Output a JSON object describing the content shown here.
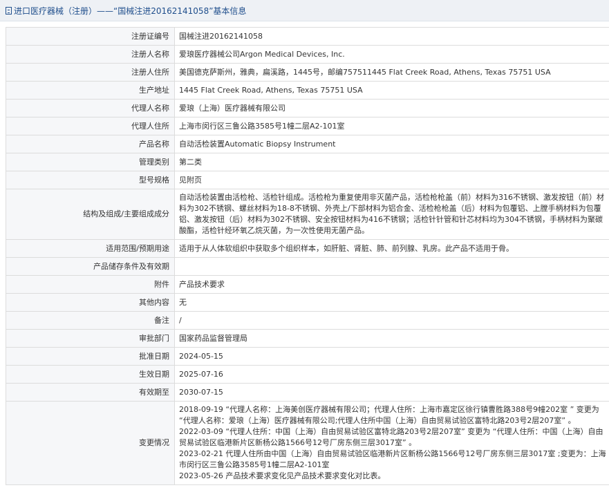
{
  "header": {
    "title": "进口医疗器械（注册）——“国械注进20162141058”基本信息"
  },
  "rows": [
    {
      "label": "注册证编号",
      "value": "国械注进20162141058"
    },
    {
      "label": "注册人名称",
      "value": "爱琅医疗器械公司Argon Medical Devices, Inc."
    },
    {
      "label": "注册人住所",
      "value": "美国德克萨斯州，雅典，扁溪路，1445号，邮编757511445 Flat Creek Road, Athens, Texas 75751 USA"
    },
    {
      "label": "生产地址",
      "value": "1445 Flat Creek Road, Athens, Texas 75751 USA"
    },
    {
      "label": "代理人名称",
      "value": "爱琅（上海）医疗器械有限公司"
    },
    {
      "label": "代理人住所",
      "value": "上海市闵行区三鲁公路3585号1幢二层A2-101室"
    },
    {
      "label": "产品名称",
      "value": "自动活检装置Automatic Biopsy Instrument"
    },
    {
      "label": "管理类别",
      "value": "第二类"
    },
    {
      "label": "型号规格",
      "value": "见附页"
    },
    {
      "label": "结构及组成/主要组成成分",
      "value": "自动活检装置由活检枪、活检针组成。活检枪为重复使用非灭菌产品，活检枪枪盖（前）材料为316不锈钢、激发按钮（前）材料为302不锈钢、螺丝材料为18-8不锈钢、外壳上/下部材料为铝合金、活检枪枪盖（后）材料为包覆铝、上膛手柄材料为包覆铝、激发按钮（后）材料为302不锈钢、安全按钮材料为416不锈钢；活检针针管和针芯材料均为304不锈钢，手柄材料为聚碳酸酯，活检针经环氧乙烷灭菌，为一次性使用无菌产品。"
    },
    {
      "label": "适用范围/预期用途",
      "value": "适用于从人体软组织中获取多个组织样本，如肝脏、肾脏、肺、前列腺、乳房。此产品不适用于骨。"
    },
    {
      "label": "产品储存条件及有效期",
      "value": ""
    },
    {
      "label": "附件",
      "value": "产品技术要求"
    },
    {
      "label": "其他内容",
      "value": "无"
    },
    {
      "label": "备注",
      "value": "/"
    },
    {
      "label": "审批部门",
      "value": "国家药品监督管理局"
    },
    {
      "label": "批准日期",
      "value": "2024-05-15"
    },
    {
      "label": "生效日期",
      "value": "2025-07-16"
    },
    {
      "label": "有效期至",
      "value": "2030-07-15"
    }
  ],
  "changes": {
    "label": "变更情况",
    "lines": [
      "2018-09-19 “代理人名称：上海美创医疗器械有限公司；代理人住所：上海市嘉定区徐行镇曹胜路388号9幢202室 ” 变更为 “代理人名称：爱琅（上海）医疗器械有限公司;代理人住所中国（上海）自由贸易试验区富特北路203号2层207室” 。",
      "2022-03-09 “代理人住所：中国（上海）自由贸易试验区富特北路203号2层207室” 变更为 “代理人住所：中国（上海）自由贸易试验区临港新片区新杨公路1566号12号厂房东侧三层3017室” 。",
      "2023-02-21 代理人住所由中国（上海）自由贸易试验区临港新片区新杨公路1566号12号厂房东侧三层3017室 ;变更为：上海市闵行区三鲁公路3585号1幢二层A2-101室",
      "2023-05-26 产品技术要求变化见产品技术要求变化对比表。"
    ]
  }
}
